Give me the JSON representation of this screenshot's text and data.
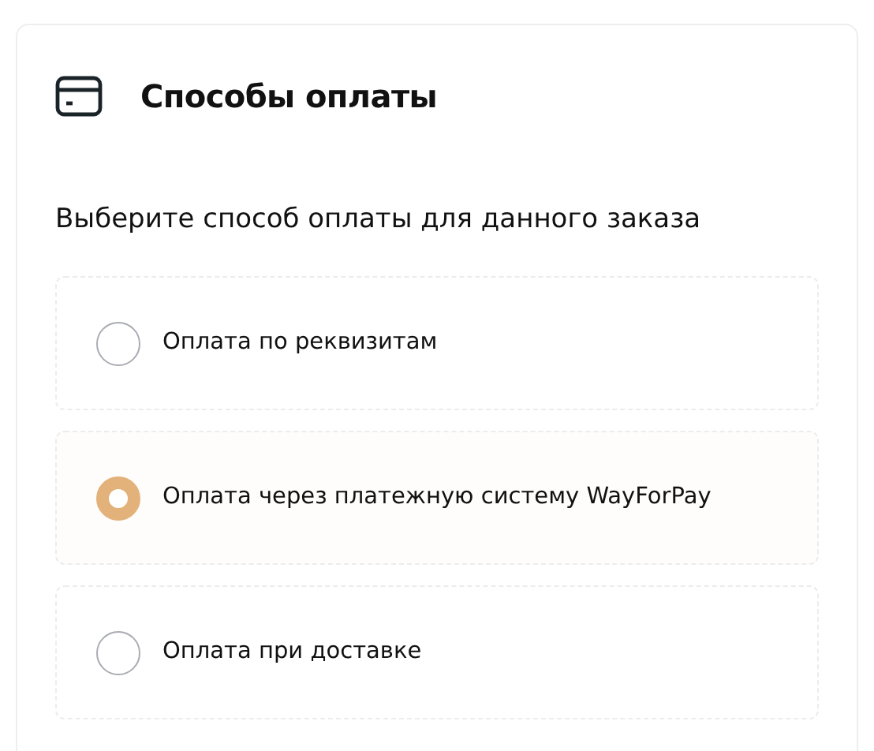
{
  "card": {
    "title": "Способы оплаты",
    "subtitle": "Выберите способ оплаты для данного заказа"
  },
  "options": [
    {
      "label": "Оплата по реквизитам",
      "selected": false
    },
    {
      "label": "Оплата через платежную систему WayForPay",
      "selected": true
    },
    {
      "label": "Оплата при доставке",
      "selected": false
    }
  ]
}
